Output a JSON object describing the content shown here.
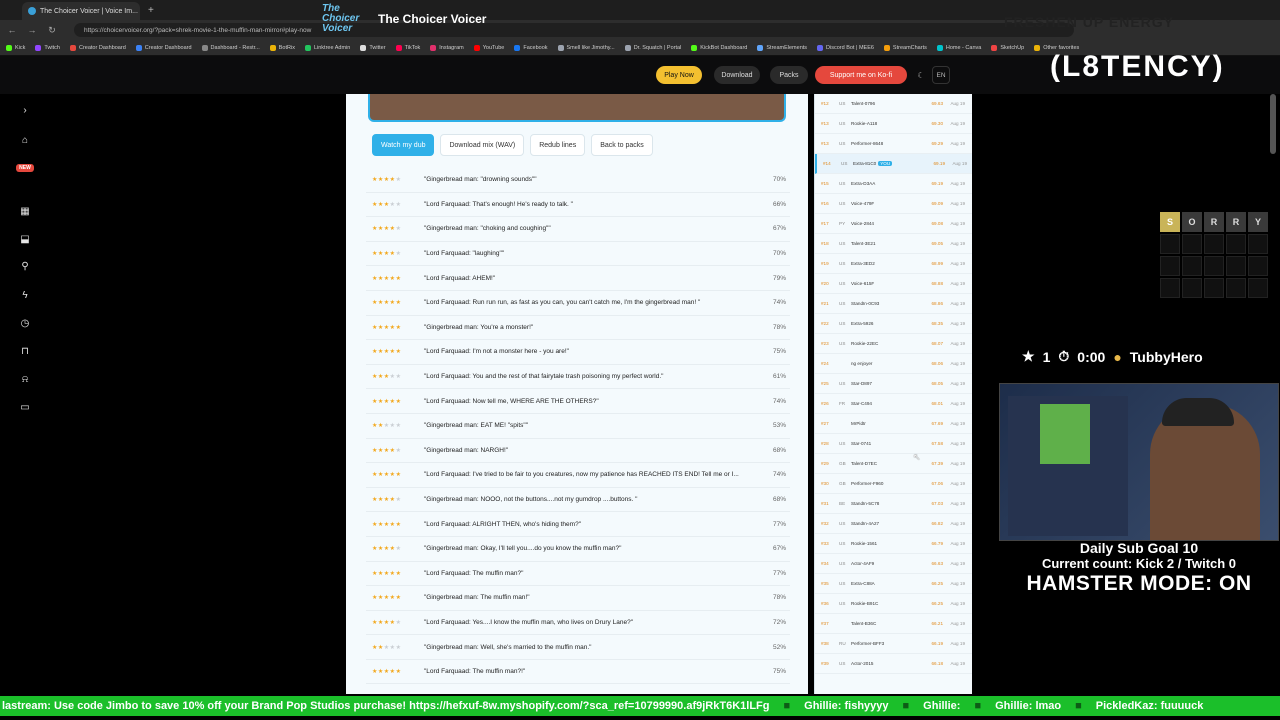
{
  "browser": {
    "tab_title": "The Choicer Voicer | Voice Im...",
    "url": "https://choicervoicer.org/?pack=shrek-movie-1-the-muffin-man-mirror#play-now",
    "bookmarks": [
      "Kick",
      "Twitch",
      "Creator Dashboard",
      "Creator Dashboard",
      "Dashboard - Restr...",
      "BotRix",
      "Linktree Admin",
      "Twitter",
      "TikTok",
      "Instagram",
      "YouTube",
      "Facebook",
      "Smell like Jimothy...",
      "Dr. Squatch | Portal",
      "KickBot Dashboard",
      "StreamElements",
      "Discord Bot | MEE6",
      "StreamCharts",
      "Home - Canva",
      "SketchUp",
      "Other favorites"
    ]
  },
  "site": {
    "title": "The Choicer Voicer",
    "logo_text": "The Choicer Voicer",
    "nav": {
      "play": "Play Now",
      "download": "Download",
      "packs": "Packs",
      "kofi": "Support me on Ko-fi",
      "lang": "EN"
    }
  },
  "rail": {
    "new_badge": "NEW"
  },
  "actions": {
    "watch": "Watch my dub",
    "download_mix": "Download mix (WAV)",
    "redub": "Redub lines",
    "back": "Back to packs"
  },
  "lines": [
    {
      "stars": 4,
      "text": "\"Gingerbread man: \"drowning sounds\"\"",
      "pct": "70%"
    },
    {
      "stars": 3,
      "text": "\"Lord Farquaad: That's enough! He's ready to talk. \"",
      "pct": "66%"
    },
    {
      "stars": 4,
      "text": "\"Gingerbread man: \"choking and coughing\"\"",
      "pct": "67%"
    },
    {
      "stars": 4,
      "text": "\"Lord Farquaad: \"laughing\"\"",
      "pct": "70%"
    },
    {
      "stars": 5,
      "text": "\"Lord Farquaad: AHEM!\"",
      "pct": "79%"
    },
    {
      "stars": 5,
      "text": "\"Lord Farquaad: Run run run, as fast as you can, you can't catch me, I'm the gingerbread man! \"",
      "pct": "74%"
    },
    {
      "stars": 5,
      "text": "\"Gingerbread man: You're a monster!\"",
      "pct": "78%"
    },
    {
      "stars": 5,
      "text": "\"Lord Farquaad: I'm not a monster here - you are!\"",
      "pct": "75%"
    },
    {
      "stars": 3,
      "text": "\"Lord Farquaad: You and the rest of that fairytale trash poisoning my perfect world.\"",
      "pct": "61%"
    },
    {
      "stars": 5,
      "text": "\"Lord Farquaad: Now tell me, WHERE ARE THE OTHERS?\"",
      "pct": "74%"
    },
    {
      "stars": 2,
      "text": "\"Gingerbread man: EAT ME! \"spits\"\"",
      "pct": "53%"
    },
    {
      "stars": 4,
      "text": "\"Gingerbread man: NARGH!\"",
      "pct": "68%"
    },
    {
      "stars": 5,
      "text": "\"Lord Farquaad: I've tried to be fair to you creatures, now my patience has REACHED ITS END! Tell me or I...",
      "pct": "74%"
    },
    {
      "stars": 4,
      "text": "\"Gingerbread man: NOOO, not the buttons....not my gumdrop ....buttons. \"",
      "pct": "68%"
    },
    {
      "stars": 5,
      "text": "\"Lord Farquaad: ALRIGHT THEN, who's hiding them?\"",
      "pct": "77%"
    },
    {
      "stars": 4,
      "text": "\"Gingerbread man: Okay, I'll tell you....do you know the muffin man?\"",
      "pct": "67%"
    },
    {
      "stars": 5,
      "text": "\"Lord Farquaad: The muffin man?\"",
      "pct": "77%"
    },
    {
      "stars": 5,
      "text": "\"Gingerbread man: The muffin man!\"",
      "pct": "78%"
    },
    {
      "stars": 4,
      "text": "\"Lord Farquaad: Yes....I know the muffin man, who lives on Drury Lane?\"",
      "pct": "72%"
    },
    {
      "stars": 2,
      "text": "\"Gingerbread man: Well, she's married to the muffin man.\"",
      "pct": "52%"
    },
    {
      "stars": 5,
      "text": "\"Lord Farquaad: The muffin man?!\"",
      "pct": "75%"
    }
  ],
  "leaderboard": [
    {
      "rank": "#12",
      "cc": "US",
      "name": "Talent-0796",
      "score": "69.63",
      "date": "Aug 19"
    },
    {
      "rank": "#13",
      "cc": "US",
      "name": "Rookie-A118",
      "score": "69.30",
      "date": "Aug 19"
    },
    {
      "rank": "#13",
      "cc": "US",
      "name": "Performer-8648",
      "score": "69.29",
      "date": "Aug 19"
    },
    {
      "rank": "#14",
      "cc": "US",
      "name": "Extra-81C0",
      "score": "69.19",
      "date": "Aug 19",
      "you": "YOU",
      "hl": true
    },
    {
      "rank": "#15",
      "cc": "US",
      "name": "Extra-D3AA",
      "score": "69.19",
      "date": "Aug 19"
    },
    {
      "rank": "#16",
      "cc": "US",
      "name": "Voice-479F",
      "score": "69.09",
      "date": "Aug 19"
    },
    {
      "rank": "#17",
      "cc": "PY",
      "name": "Voice-2844",
      "score": "69.08",
      "date": "Aug 19"
    },
    {
      "rank": "#18",
      "cc": "US",
      "name": "Talent-3E21",
      "score": "69.05",
      "date": "Aug 19"
    },
    {
      "rank": "#19",
      "cc": "US",
      "name": "Extra-3ED2",
      "score": "68.99",
      "date": "Aug 19"
    },
    {
      "rank": "#20",
      "cc": "US",
      "name": "Voice-615F",
      "score": "68.88",
      "date": "Aug 19"
    },
    {
      "rank": "#21",
      "cc": "US",
      "name": "StandIn-0C93",
      "score": "68.86",
      "date": "Aug 19"
    },
    {
      "rank": "#22",
      "cc": "US",
      "name": "Extra-5926",
      "score": "68.35",
      "date": "Aug 19"
    },
    {
      "rank": "#23",
      "cc": "US",
      "name": "Rookie-22EC",
      "score": "68.07",
      "date": "Aug 19"
    },
    {
      "rank": "#24",
      "cc": "",
      "name": "ng enjoyer",
      "score": "68.06",
      "date": "Aug 19"
    },
    {
      "rank": "#25",
      "cc": "US",
      "name": "Star-D897",
      "score": "68.05",
      "date": "Aug 19"
    },
    {
      "rank": "#26",
      "cc": "FR",
      "name": "Star-C494",
      "score": "68.01",
      "date": "Aug 19"
    },
    {
      "rank": "#27",
      "cc": "",
      "name": "MrPidtr",
      "score": "67.69",
      "date": "Aug 19"
    },
    {
      "rank": "#28",
      "cc": "US",
      "name": "Star-0741",
      "score": "67.58",
      "date": "Aug 19"
    },
    {
      "rank": "#29",
      "cc": "GB",
      "name": "Talent-D7EC",
      "score": "67.39",
      "date": "Aug 19"
    },
    {
      "rank": "#30",
      "cc": "GB",
      "name": "Performer-F960",
      "score": "67.06",
      "date": "Aug 19"
    },
    {
      "rank": "#31",
      "cc": "BE",
      "name": "StandIn-5C78",
      "score": "67.03",
      "date": "Aug 19"
    },
    {
      "rank": "#32",
      "cc": "US",
      "name": "StandIn-4A27",
      "score": "66.82",
      "date": "Aug 19"
    },
    {
      "rank": "#33",
      "cc": "US",
      "name": "Rookie-1561",
      "score": "66.79",
      "date": "Aug 19"
    },
    {
      "rank": "#34",
      "cc": "US",
      "name": "Actor-4AF9",
      "score": "66.63",
      "date": "Aug 19"
    },
    {
      "rank": "#35",
      "cc": "US",
      "name": "Extra-C88A",
      "score": "66.25",
      "date": "Aug 19"
    },
    {
      "rank": "#36",
      "cc": "US",
      "name": "Rookie-B91C",
      "score": "66.25",
      "date": "Aug 19"
    },
    {
      "rank": "#37",
      "cc": "",
      "name": "Talent-B36C",
      "score": "66.21",
      "date": "Aug 19"
    },
    {
      "rank": "#38",
      "cc": "RU",
      "name": "Performer-BFF3",
      "score": "66.19",
      "date": "Aug 19"
    },
    {
      "rank": "#39",
      "cc": "US",
      "name": "Actor-2015",
      "score": "66.18",
      "date": "Aug 19"
    }
  ],
  "overlay": {
    "brand": "(L8TENCY)",
    "ghost_text": "FRESHEN UP ENERGY",
    "tiles": [
      "S",
      "O",
      "R",
      "R",
      "Y"
    ],
    "stars": "1",
    "timer": "0:00",
    "username": "TubbyHero",
    "sub_goal": "Daily Sub Goal 10",
    "count": "Current count: Kick 2 / Twitch 0",
    "mode": "HAMSTER MODE: ON",
    "ticker": [
      "lastream: Use code Jimbo to save 10% off your Brand Pop Studios purchase! https://hefxuf-8w.myshopify.com/?sca_ref=10799990.af9jRkT6K1lLFg",
      "Ghillie: fishyyyy",
      "Ghillie:",
      "Ghillie: lmao",
      "PickledKaz: fuuuuck"
    ]
  },
  "colors": {
    "accent": "#2fb0e8",
    "play": "#f4c030",
    "kofi": "#e5483d",
    "ticker": "#1bbf2a",
    "star": "#f2a81d"
  }
}
